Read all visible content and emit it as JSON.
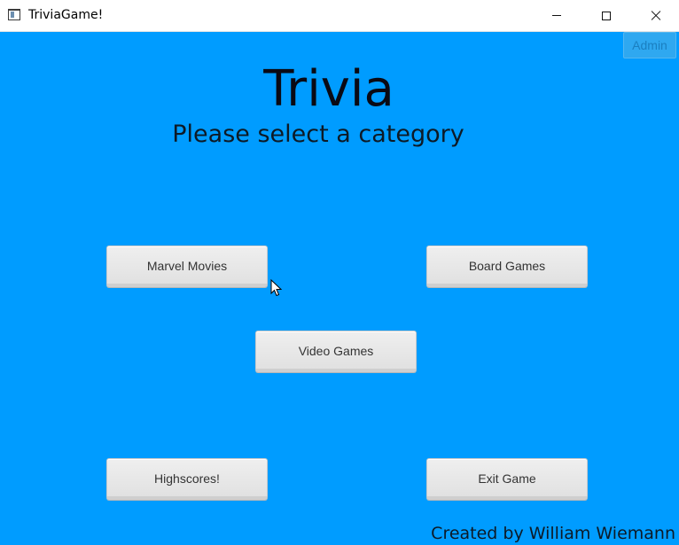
{
  "window": {
    "title": "TriviaGame!",
    "icon": "app-window-icon",
    "controls": [
      "minimize-icon",
      "maximize-icon",
      "close-icon"
    ]
  },
  "header": {
    "admin_label": "Admin",
    "title": "Trivia",
    "subtitle": "Please select a category"
  },
  "buttons": {
    "marvel": "Marvel Movies",
    "board": "Board Games",
    "video": "Video Games",
    "highscores": "Highscores!",
    "exit": "Exit Game"
  },
  "footer": {
    "credit": "Created by William Wiemann"
  },
  "colors": {
    "background": "#009cff",
    "button": "#e6e6e6",
    "text": "#0a0a14"
  }
}
